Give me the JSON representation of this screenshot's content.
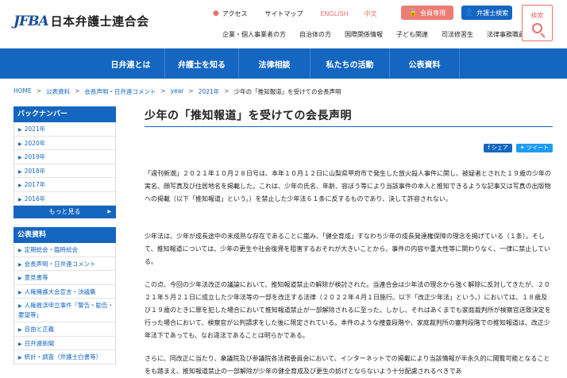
{
  "header": {
    "logo_mark": "JFBA",
    "logo_text": "日本弁護士連合会",
    "util_links": [
      "アクセス",
      "サイトマップ",
      "ENGLISH",
      "中文"
    ],
    "member_button": "会員専用",
    "lawyer_search_button": "弁護士検索",
    "search_label": "検索",
    "audience_links": [
      "企業・個人事業者の方",
      "自治体の方",
      "国際関係情報",
      "子ども関連",
      "司法修習生",
      "法律事務職員"
    ]
  },
  "nav": {
    "items": [
      "日弁連とは",
      "弁護士を知る",
      "法律相談",
      "私たちの活動",
      "公表資料"
    ]
  },
  "breadcrumb": [
    "HOME",
    "公表資料",
    "会長声明・日弁連コメント",
    "year",
    "2021年",
    "少年の「推知報道」を受けての会長声明"
  ],
  "sidebar": {
    "backnumber_title": "バックナンバー",
    "years": [
      "2021年",
      "2020年",
      "2019年",
      "2018年",
      "2017年",
      "2016年"
    ],
    "more_label": "もっと見る",
    "public_title": "公表資料",
    "public_items": [
      "定期総会・臨時総会",
      "会長声明・日弁連コメント",
      "意見書等",
      "人権擁護大会宣言・決議集",
      "人権救済申立事件「警告・勧告・要望等」",
      "自由と正義",
      "日弁連新聞",
      "統計・調査（弁護士白書等）"
    ]
  },
  "content": {
    "title": "少年の「推知報道」を受けての会長声明",
    "share_fb": "シェア",
    "share_tw": "ツイート",
    "paragraphs": [
      "「週刊新潮」２０２１年１０月２８日号は、本年１０月１２日に山梨県甲府市で発生した放火殺人事件に関し、被疑者とされた１９歳の少年の実名、顔写真及び住居地名を掲載した。これは、少年の氏名、年齢、容ぼう等により当該事件の本人と推知できるような記事又は写真の出版物への掲載（以下「推知報道」という。）を禁止した少年法６１条に反するものであり、決して許容されない。",
      "少年法は、少年が成長途中の未成熟な存在であることに鑑み、「健全育成」すなわち少年の成長発達権保障の理念を掲げている（１条）。そして、推知報道については、少年の更生や社会復帰を阻害するおそれが大きいことから、事件の内容や重大性等に関わりなく、一律に禁止している。",
      "この点、今回の少年法改正の議論において、推知報道禁止の解除が検討された。当連合会は少年法の理念から強く解除に反対してきたが、２０２１年５月２１日に成立した少年法等の一部を改正する法律（２０２２年４月１日施行。以下「改正少年法」という。）においては、１８歳及び１９歳のときに罪を犯した場合において推知報道禁止が一部解除されるに至った。しかし、それはあくまでも家庭裁判所が検察官送致決定を行った場合において、検察官が公判請求をした後に限定されている。本件のような捜査段階や、家庭裁判所の審判段階での推知報道は、改正少年法下であっても、なお違法であることは明らかである。",
      "さらに、同改正に当たり、衆議院及び参議院各法務委員会において、インターネットでの掲載により当該情報が半永久的に閲覧可能となることをも踏まえ、推知報道禁止の一部解除が少年の健全育成及び更生の妨げとならないよう十分配慮されるべきであ"
    ]
  }
}
